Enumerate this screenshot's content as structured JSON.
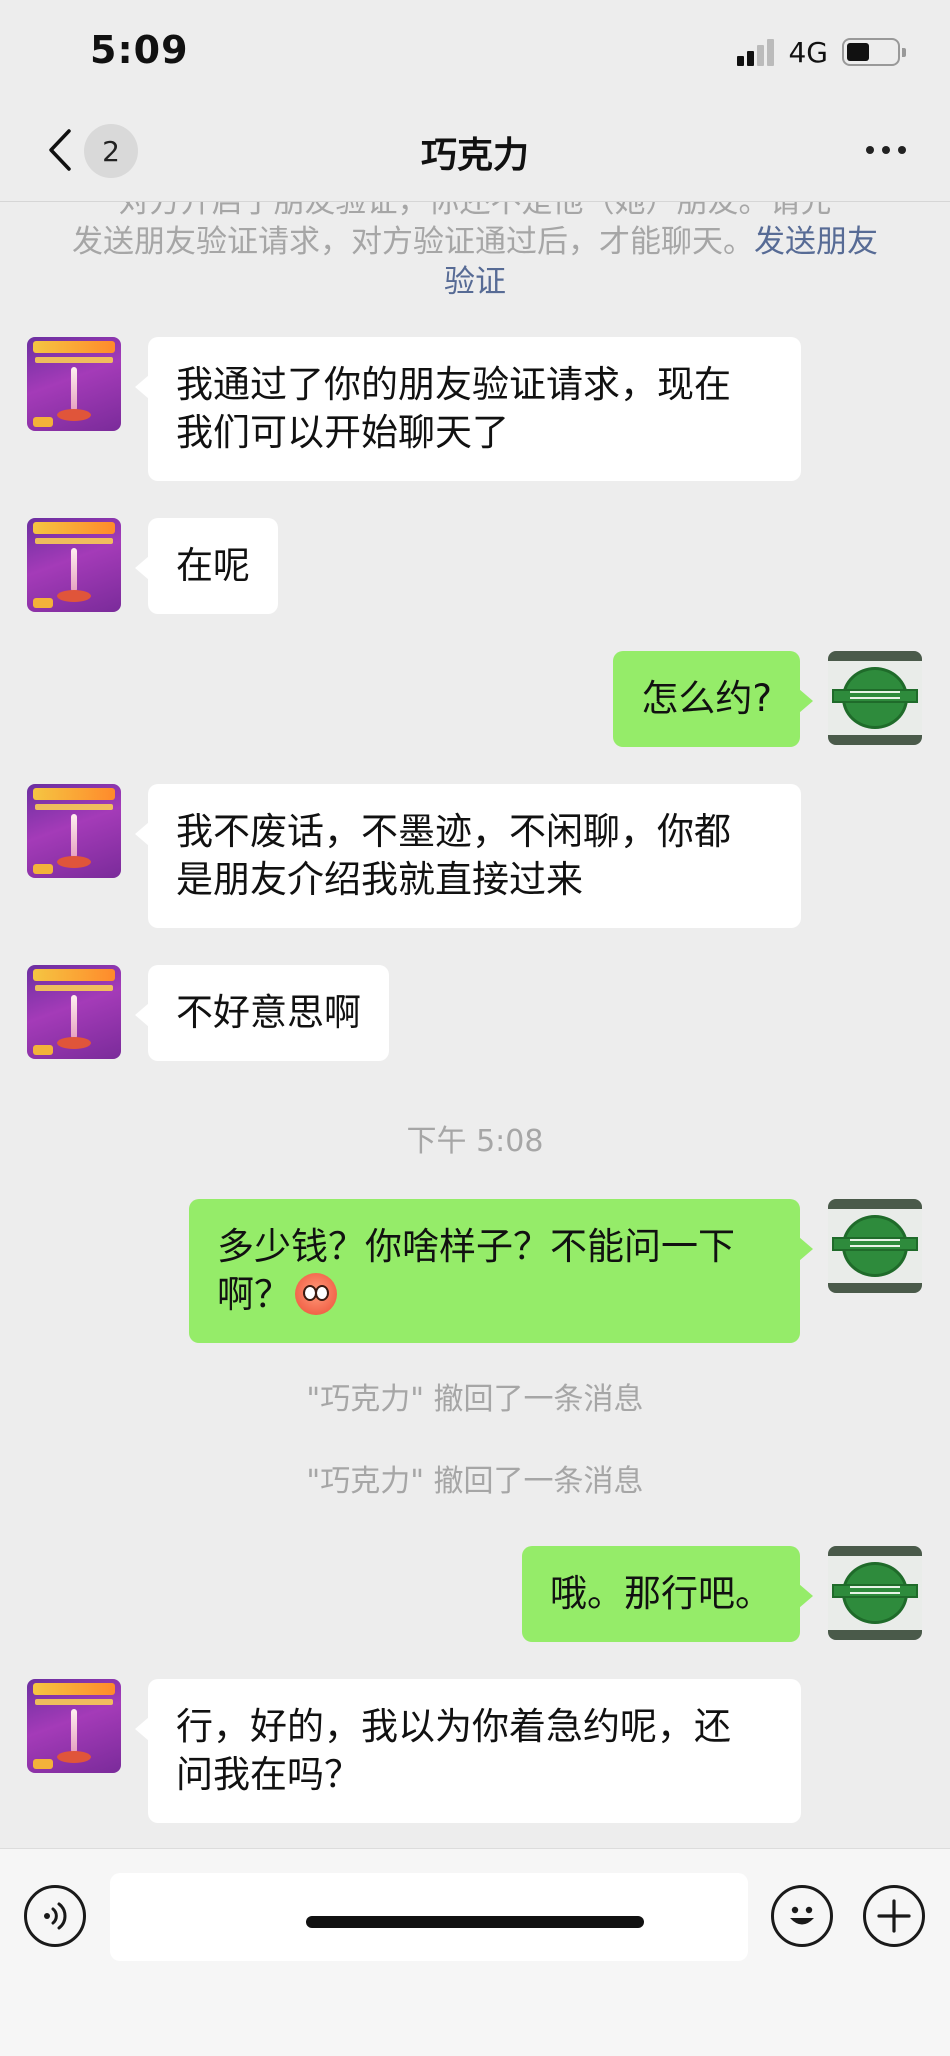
{
  "status_bar": {
    "time": "5:09",
    "network": "4G"
  },
  "nav": {
    "unread_count": "2",
    "title": "巧克力"
  },
  "system_notice": {
    "text": "发送朋友验证请求，对方验证通过后，才能聊天。",
    "link": "发送朋友验证",
    "prefix_line": "对方开启了朋友验证，你还不是他（她）朋友。请先"
  },
  "messages": [
    {
      "from": "them",
      "text_line1": "我通过了你的朋友验证请求，现在",
      "text_line2": "我们可以开始聊天了"
    },
    {
      "from": "them",
      "text_line1": "在呢"
    },
    {
      "from": "me",
      "text_line1": "怎么约?"
    },
    {
      "from": "them",
      "text_line1": "我不废话，不墨迹，不闲聊，你都",
      "text_line2": "是朋友介绍我就直接过来"
    },
    {
      "from": "them",
      "text_line1": "不好意思啊"
    },
    {
      "from": "me",
      "text_line1": "多少钱？你啥样子？不能问一下",
      "text_line2": "啊？",
      "emoji": "flushed-face"
    },
    {
      "from": "me",
      "text_line1": "哦。那行吧。"
    },
    {
      "from": "them",
      "text_line1": "行，好的，我以为你着急约呢，还",
      "text_line2": "问我在吗？"
    }
  ],
  "time_label": "下午 5:08",
  "recall_notes": [
    "\"巧克力\" 撤回了一条消息",
    "\"巧克力\" 撤回了一条消息"
  ],
  "input": {
    "placeholder": ""
  },
  "colors": {
    "background": "#ededed",
    "my_bubble": "#95ec69",
    "their_bubble": "#ffffff",
    "link": "#576b95"
  },
  "icons": [
    "back-chevron-icon",
    "more-icon",
    "voice-icon",
    "emoji-icon",
    "plus-icon"
  ]
}
